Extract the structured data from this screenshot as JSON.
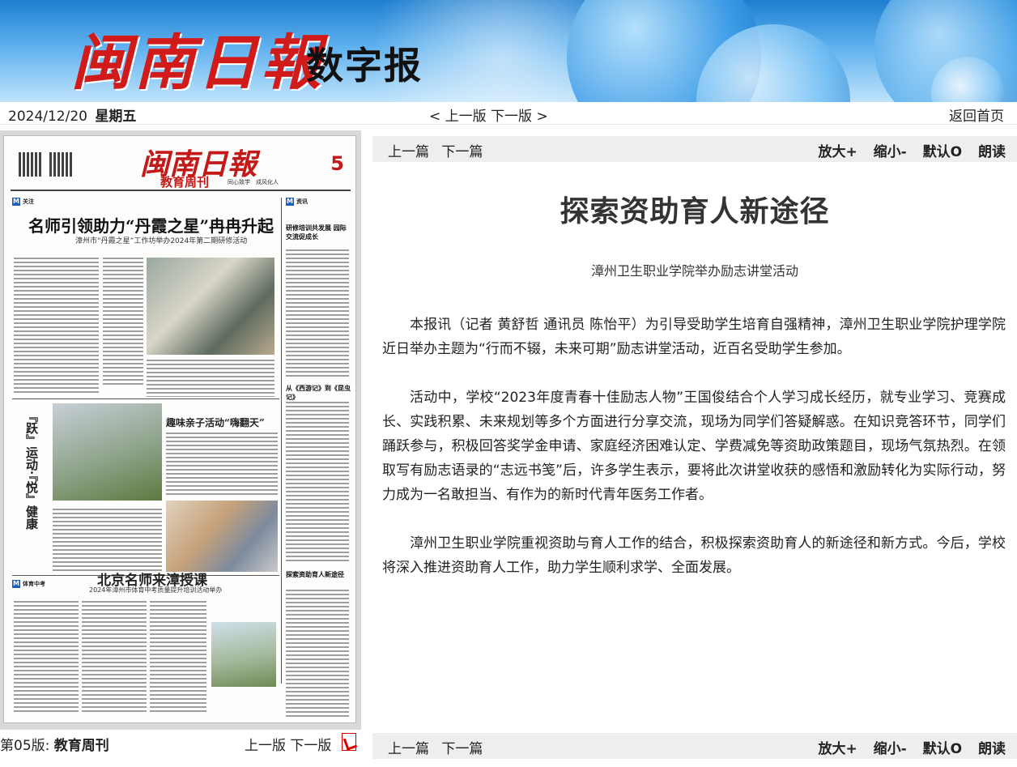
{
  "header": {
    "logo_text": "闽南日報",
    "logo_sub": "数字报"
  },
  "datebar": {
    "date": "2024/12/20",
    "weekday": "星期五",
    "prev_edition": "< 上一版",
    "next_edition": "下一版 >",
    "home": "返回首页"
  },
  "page": {
    "edition_label": "第05版:",
    "edition_name": "教育周刊",
    "prev_version": "上一版",
    "next_version": "下一版"
  },
  "newspaper": {
    "masthead": "闽南日報",
    "edition": "教育周刊",
    "motto": "同心致学　成风化人",
    "page_number": "5",
    "section1": "关注",
    "headline1": "名师引领助力“丹霞之星”冉冉升起",
    "subheadline1": "漳州市“丹霞之星”工作坊举办2024年第二期研修活动",
    "section2": "资讯",
    "side_headline1": "研修培训共发展 园际交流促成长",
    "side_headline2": "从《西游记》到《昆虫记》",
    "side_headline3": "探索资助育人新途径",
    "vertical_title": "『跃』运动·『悦』健康",
    "feature_headline": "趣味亲子活动“嗨翻天”",
    "section3": "体育中考",
    "headline2": "北京名师来漳授课",
    "subheadline2": "2024年漳州市体育中考质量提升培训活动举办"
  },
  "toolbar": {
    "prev_article": "上一篇",
    "next_article": "下一篇",
    "zoom_in": "放大+",
    "zoom_out": "缩小-",
    "reset": "默认O",
    "read": "朗读"
  },
  "article": {
    "title": "探索资助育人新途径",
    "subtitle": "漳州卫生职业学院举办励志讲堂活动",
    "paragraphs": [
      "本报讯（记者 黄舒哲 通讯员 陈怡平）为引导受助学生培育自强精神，漳州卫生职业学院护理学院近日举办主题为“行而不辍，未来可期”励志讲堂活动，近百名受助学生参加。",
      "活动中，学校“2023年度青春十佳励志人物”王国俊结合个人学习成长经历，就专业学习、竞赛成长、实践积累、未来规划等多个方面进行分享交流，现场为同学们答疑解惑。在知识竞答环节，同学们踊跃参与，积极回答奖学金申请、家庭经济困难认定、学费减免等资助政策题目，现场气氛热烈。在领取写有励志语录的“志远书笺”后，许多学生表示，要将此次讲堂收获的感悟和激励转化为实际行动，努力成为一名敢担当、有作为的新时代青年医务工作者。",
      "漳州卫生职业学院重视资助与育人工作的结合，积极探索资助育人的新途径和新方式。今后，学校将深入推进资助育人工作，助力学生顺利求学、全面发展。"
    ]
  },
  "colors": {
    "brand_red": "#d11b1b",
    "banner_blue": "#1e7fd0",
    "toolbar_bg": "#eeeeee"
  }
}
